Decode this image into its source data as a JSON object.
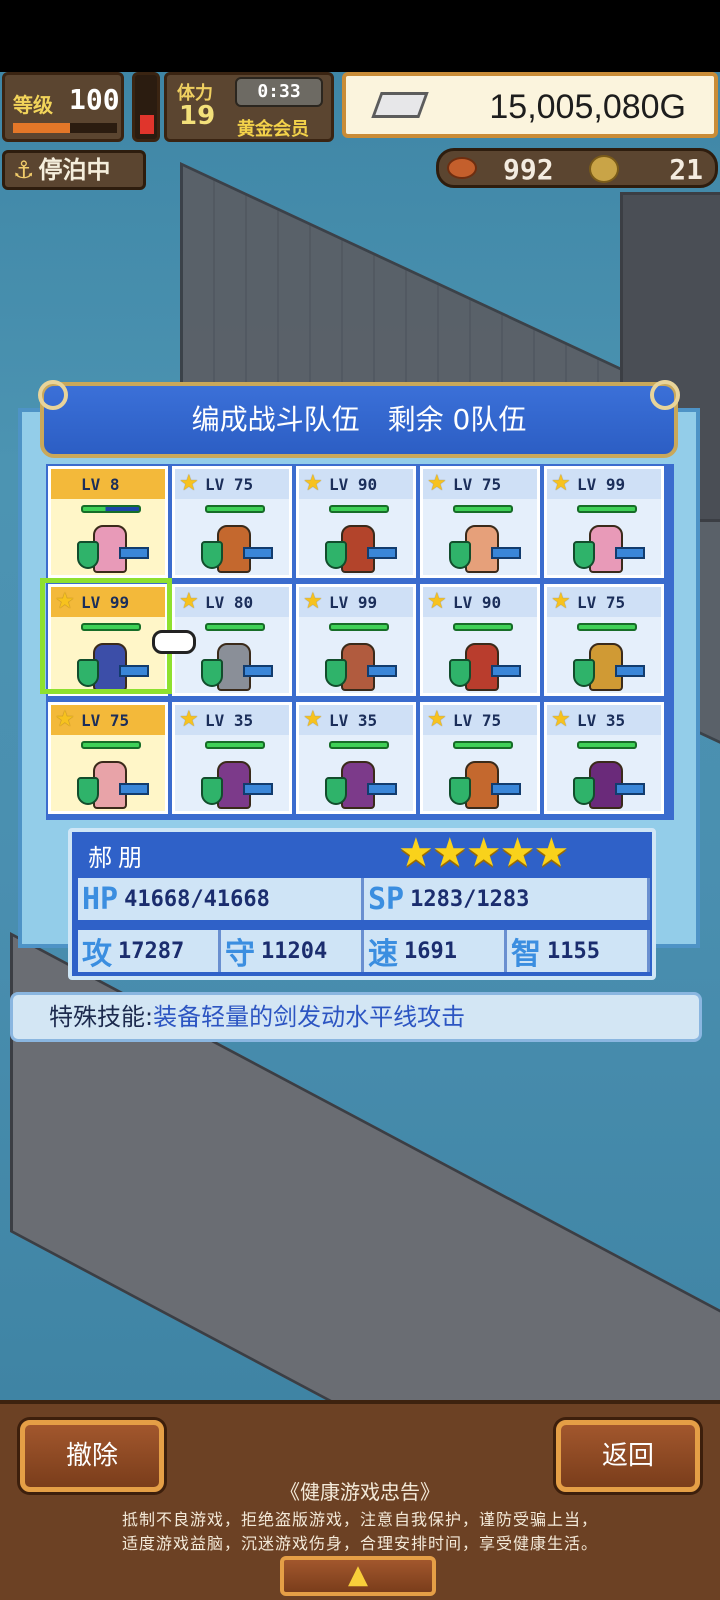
{
  "hud": {
    "level_label": "等级",
    "level_value": "100",
    "xp_fraction": 0.55,
    "stamina_fraction": 0.35,
    "stamina_label": "体力",
    "stamina_value": "19",
    "timer": "0:33",
    "membership": "黄金会员",
    "money": "15,005,080G",
    "dock_status": "停泊中",
    "food": "992",
    "coins": "21"
  },
  "panel": {
    "title": "编成战斗队伍　剩余 0队伍"
  },
  "roster": [
    {
      "lv": "LV   8",
      "star": false,
      "color": "#e89ab8",
      "hp": 0.4
    },
    {
      "lv": "LV  75",
      "star": true,
      "color": "#c4682e",
      "hp": 1
    },
    {
      "lv": "LV  90",
      "star": true,
      "color": "#b3442b",
      "hp": 1
    },
    {
      "lv": "LV  75",
      "star": true,
      "color": "#e6a07a",
      "hp": 1
    },
    {
      "lv": "LV  99",
      "star": true,
      "color": "#e89ab8",
      "hp": 1
    },
    {
      "lv": "LV  99",
      "star": true,
      "color": "#3c4ea8",
      "hp": 1
    },
    {
      "lv": "LV  80",
      "star": true,
      "color": "#8a8f98",
      "hp": 1
    },
    {
      "lv": "LV  99",
      "star": true,
      "color": "#b15b3e",
      "hp": 1
    },
    {
      "lv": "LV  90",
      "star": true,
      "color": "#b93d2d",
      "hp": 1
    },
    {
      "lv": "LV  75",
      "star": true,
      "color": "#d09a34",
      "hp": 1
    },
    {
      "lv": "LV  75",
      "star": true,
      "color": "#e8a3a8",
      "hp": 1
    },
    {
      "lv": "LV  35",
      "star": true,
      "color": "#7c3a8a",
      "hp": 1
    },
    {
      "lv": "LV  35",
      "star": true,
      "color": "#7c3a8a",
      "hp": 1
    },
    {
      "lv": "LV  75",
      "star": true,
      "color": "#c4682e",
      "hp": 1
    },
    {
      "lv": "LV  35",
      "star": true,
      "color": "#6a2a7a",
      "hp": 1
    }
  ],
  "selected_index": 5,
  "info": {
    "name": "郝朋",
    "stars": "★★★★★",
    "hp_label": "HP",
    "hp_value": "41668/41668",
    "sp_label": "SP",
    "sp_value": "1283/1283",
    "atk_label": "攻",
    "atk_value": "17287",
    "def_label": "守",
    "def_value": "11204",
    "spd_label": "速",
    "spd_value": "1691",
    "int_label": "智",
    "int_value": "1155"
  },
  "skill": {
    "label": "特殊技能:",
    "value": "装备轻量的剑发动水平线攻击"
  },
  "bottom": {
    "remove_label": "撤除",
    "back_label": "返回",
    "notice_title": "《健康游戏忠告》",
    "notice_line1": "抵制不良游戏，拒绝盗版游戏，注意自我保护，谨防受骗上当，",
    "notice_line2": "适度游戏益脑，沉迷游戏伤身，合理安排时间，享受健康生活。",
    "up_symbol": "▲"
  }
}
